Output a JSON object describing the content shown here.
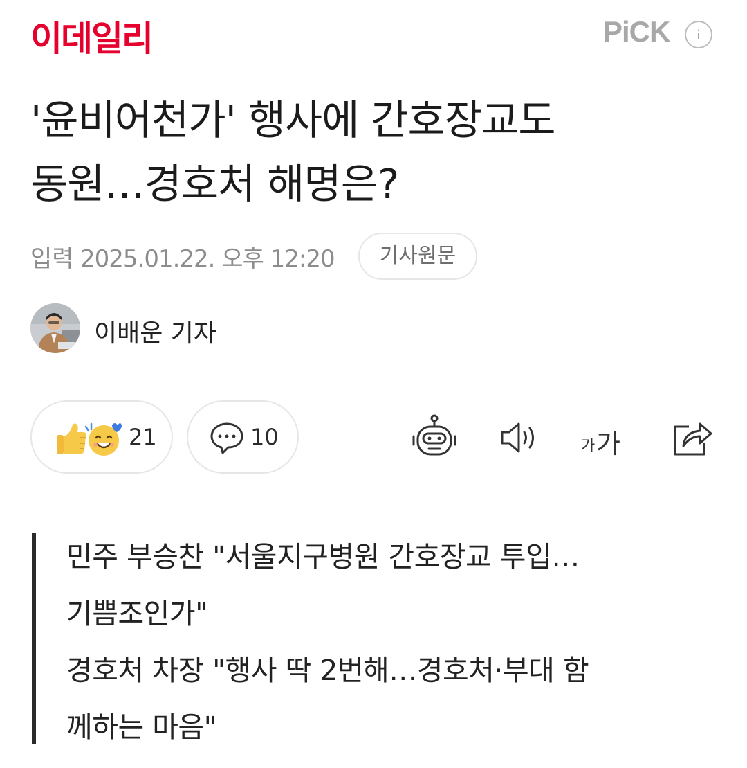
{
  "header": {
    "logo_text": "이데일리",
    "pick_label": "PiCK",
    "info_icon_label": "i"
  },
  "article": {
    "title_line1": "'윤비어천가' 행사에 간호장교도",
    "title_line2": "동원…경호처 해명은?",
    "date_label": "입력",
    "date_value": "2025.01.22. 오후 12:20",
    "original_button": "기사원문",
    "reporter_name": "이배운 기자"
  },
  "actions": {
    "reaction_count": "21",
    "comment_count": "10",
    "icons": [
      "reaction-emoji-icon",
      "comment-icon",
      "robot-summary-icon",
      "speaker-icon",
      "font-size-icon",
      "share-icon"
    ],
    "font_size_label_small": "가",
    "font_size_label_large": "가"
  },
  "summary": {
    "lines": [
      "민주 부승찬 \"서울지구병원 간호장교 투입…",
      "기쁨조인가\"",
      "경호처 차장 \"행사 딱 2번해…경호처·부대 함",
      "께하는 마음\""
    ]
  },
  "colors": {
    "brand_red": "#e6002d",
    "muted_gray": "#8c8c8c",
    "border_gray": "#e6e6e6",
    "emoji_yellow": "#f7c948",
    "heart_blue": "#3d7be0"
  }
}
